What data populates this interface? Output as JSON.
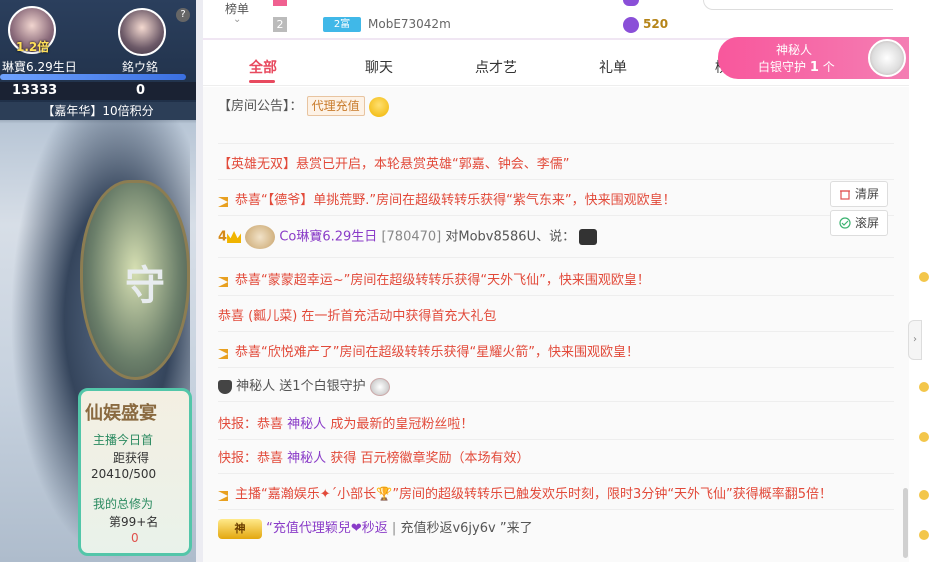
{
  "pk": {
    "multiplier": "1.2倍",
    "left_name": "琳寶6.29生日",
    "right_name": "銘ウ銘",
    "left_score": "13333",
    "right_score": "0",
    "carnival": "【嘉年华】10倍积分",
    "help": "?"
  },
  "hero": {
    "shield_char": "守",
    "card_title": "仙娱盛宴",
    "card_l1": "主播今日首",
    "card_l2": "距获得",
    "card_l3": "20410/500",
    "card_l4": "我的总修为",
    "card_l5": "第99+名",
    "card_l6": "0"
  },
  "rank": {
    "label": "榜单",
    "chevron": "⌄",
    "row_rank": "2",
    "row_badge": "2富",
    "row_user": "MobE73042m",
    "row_value": "520"
  },
  "tabs": [
    "全部",
    "聊天",
    "点才艺",
    "礼单",
    "榜"
  ],
  "mystery": {
    "name": "神秘人",
    "guard": "白银守护",
    "count": "1",
    "unit": "个"
  },
  "chat": {
    "notice_label": "【房间公告】：",
    "notice_btn": "代理充值",
    "hero_event": "【英雄无双】悬赏已开启，本轮悬赏英雄“郭嘉、钟会、李儒”",
    "msg1": "恭喜“【德爷】单挑荒野.”房间在超级转转乐获得“紫气东来”，快来围观欧皇！",
    "user_level": "4",
    "user_name": "Co琳寶6.29生日",
    "user_id": "[780470]",
    "user_to": "对Mobv8586U、说：",
    "msg2": "恭喜“蒙蒙超幸运~”房间在超级转转乐获得“天外飞仙”，快来围观欧皇！",
    "msg3": "恭喜 (瓤儿菜) 在一折首充活动中获得首充大礼包",
    "msg4": "恭喜“欣悦难产了”房间在超级转转乐获得“星耀火箭”，快来围观欧皇！",
    "msg5_user": "神秘人",
    "msg5": "送1个白银守护",
    "msg6_prefix": "快报：恭喜",
    "msg6_user": "神秘人",
    "msg6": "成为最新的皇冠粉丝啦！",
    "msg7_prefix": "快报：恭喜",
    "msg7_user": "神秘人",
    "msg7": "获得 百元榜徽章奖励（本场有效）",
    "msg8": "主播“嘉瀚娱乐✦´小部长🏆”房间的超级转转乐已触发欢乐时刻，限时3分钟“天外飞仙”获得概率翻5倍！",
    "msg9_badge": "神",
    "msg9_name": "“充值代理颖兒❤秒返",
    "msg9_sep": "|",
    "msg9_name2": "充值秒返v6jy6v",
    "msg9_tail": "”来了"
  },
  "side": {
    "clear": "清屏",
    "scroll": "滚屏"
  },
  "pill_arrow": "›"
}
